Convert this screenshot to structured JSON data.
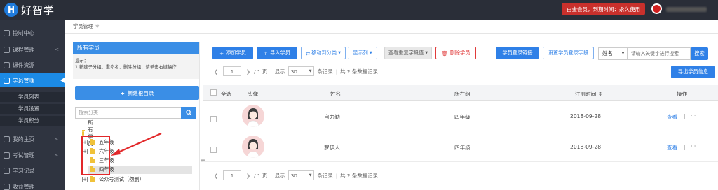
{
  "app": {
    "logo_letter": "H",
    "logo_text": "好智学",
    "vip": "白金会员，到期时间：永久使用"
  },
  "sidebar": {
    "items": [
      {
        "label": "控制中心"
      },
      {
        "label": "课程管理"
      },
      {
        "label": "课件资源"
      },
      {
        "label": "学员管理"
      },
      {
        "label": "我的主页"
      },
      {
        "label": "考试管理"
      },
      {
        "label": "学习记录"
      },
      {
        "label": "收益管理"
      }
    ],
    "sub": [
      {
        "label": "学员列表"
      },
      {
        "label": "学员设置"
      },
      {
        "label": "学员积分"
      }
    ],
    "chevron": "<"
  },
  "breadcrumb": {
    "label": "学员管理",
    "close": "✱"
  },
  "leftpanel": {
    "title": "所有学员",
    "tip_line1": "提示：",
    "tip_line2": "1.新建子分组、重命名、删除分组，请单击右键操作...",
    "new_dir": "新建根目录",
    "search_placeholder": "搜索分类",
    "tree": [
      {
        "label": "所有学员",
        "plus": false
      },
      {
        "label": "五年级",
        "plus": true
      },
      {
        "label": "六年级",
        "plus": true
      },
      {
        "label": "三年级",
        "plus": false
      },
      {
        "label": "四年级",
        "plus": false
      },
      {
        "label": "公众号测试（勿删）",
        "plus": true
      }
    ]
  },
  "toolbar": {
    "add": "添加学员",
    "import": "导入学员",
    "move": "移动到分类",
    "cols": "显示列",
    "dup": "查看重复字段值",
    "del": "删除学员",
    "login_link": "学员登录链接",
    "set_login": "设置学员登录字段",
    "select": "姓名",
    "search_placeholder": "请输入关键字进行搜索",
    "search": "搜索",
    "export": "导出学员信息"
  },
  "pager": {
    "page": "1",
    "pages": "/ 1 页",
    "show": "显示",
    "size": "30",
    "records": "条记录",
    "total": "共 2 条数据记录"
  },
  "table": {
    "headers": [
      "全选",
      "头像",
      "姓名",
      "所在组",
      "注册时间 ⇕",
      "操作"
    ],
    "rows": [
      {
        "name": "自力勤",
        "group": "四年级",
        "date": "2018-09-28",
        "view": "查看",
        "sep": "|",
        "more": "···"
      },
      {
        "name": "罗伊人",
        "group": "四年级",
        "date": "2018-09-28",
        "view": "查看",
        "sep": "|",
        "more": "···"
      }
    ]
  }
}
